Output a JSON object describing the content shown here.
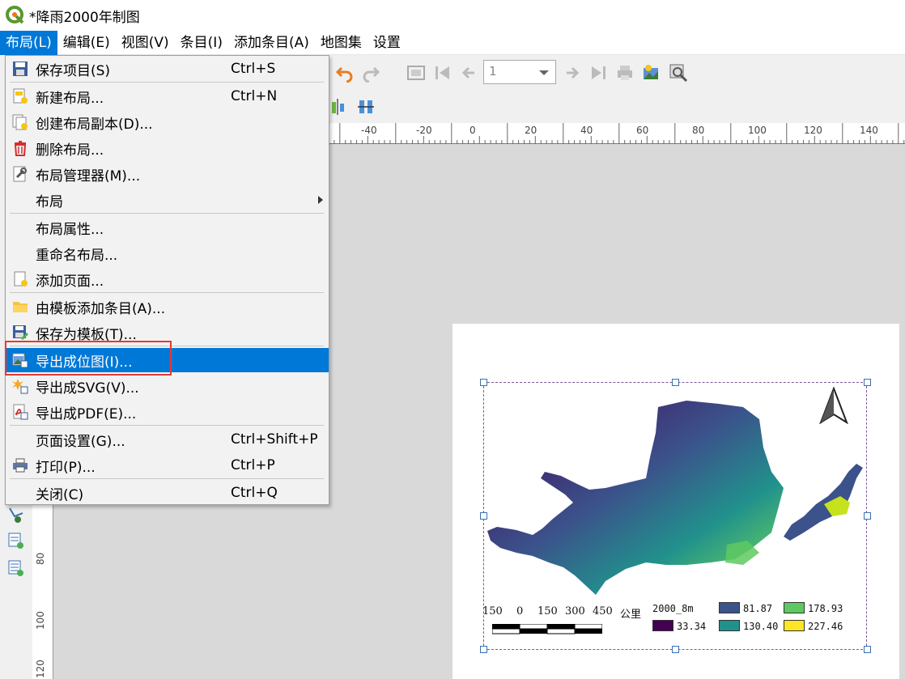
{
  "window": {
    "title": "*降雨2000年制图"
  },
  "menubar": {
    "items": [
      {
        "label": "布局(L)",
        "active": true
      },
      {
        "label": "编辑(E)"
      },
      {
        "label": "视图(V)"
      },
      {
        "label": "条目(I)"
      },
      {
        "label": "添加条目(A)"
      },
      {
        "label": "地图集"
      },
      {
        "label": "设置"
      }
    ]
  },
  "toolbar": {
    "page_value": "1"
  },
  "layout_menu": {
    "items": [
      {
        "label": "保存项目(S)",
        "shortcut": "Ctrl+S",
        "icon": "save-icon"
      },
      {
        "label": "新建布局...",
        "shortcut": "Ctrl+N",
        "icon": "new-layout-icon"
      },
      {
        "label": "创建布局副本(D)...",
        "icon": "duplicate-layout-icon"
      },
      {
        "label": "删除布局...",
        "icon": "trash-icon"
      },
      {
        "label": "布局管理器(M)...",
        "icon": "layout-manager-icon"
      },
      {
        "label": "布局",
        "submenu": true
      },
      {
        "label": "布局属性..."
      },
      {
        "label": "重命名布局..."
      },
      {
        "label": "添加页面...",
        "icon": "add-page-icon"
      },
      {
        "label": "由模板添加条目(A)...",
        "icon": "folder-icon"
      },
      {
        "label": "保存为模板(T)...",
        "icon": "save-template-icon"
      },
      {
        "label": "导出成位图(I)...",
        "icon": "export-image-icon",
        "highlighted": true
      },
      {
        "label": "导出成SVG(V)...",
        "icon": "export-svg-icon"
      },
      {
        "label": "导出成PDF(E)...",
        "icon": "export-pdf-icon"
      },
      {
        "label": "页面设置(G)...",
        "shortcut": "Ctrl+Shift+P"
      },
      {
        "label": "打印(P)...",
        "shortcut": "Ctrl+P",
        "icon": "printer-icon"
      },
      {
        "label": "关闭(C)",
        "shortcut": "Ctrl+Q"
      }
    ]
  },
  "rulers": {
    "horizontal": [
      "-40",
      "-20",
      "0",
      "20",
      "40",
      "60",
      "80",
      "100",
      "120",
      "140"
    ],
    "vertical": [
      "80",
      "100",
      "120"
    ]
  },
  "map": {
    "scalebar": {
      "labels": [
        "150",
        "0",
        "150",
        "300",
        "450"
      ],
      "unit": "公里"
    },
    "legend": {
      "title": "2000_8m",
      "entries": [
        {
          "value": "33.34",
          "color": "#440154"
        },
        {
          "value": "81.87",
          "color": "#3b528b"
        },
        {
          "value": "130.40",
          "color": "#21918c"
        },
        {
          "value": "178.93",
          "color": "#5ec962"
        },
        {
          "value": "227.46",
          "color": "#fde725"
        }
      ]
    }
  },
  "colors": {
    "accent": "#0078d7",
    "callout": "#e53935"
  }
}
